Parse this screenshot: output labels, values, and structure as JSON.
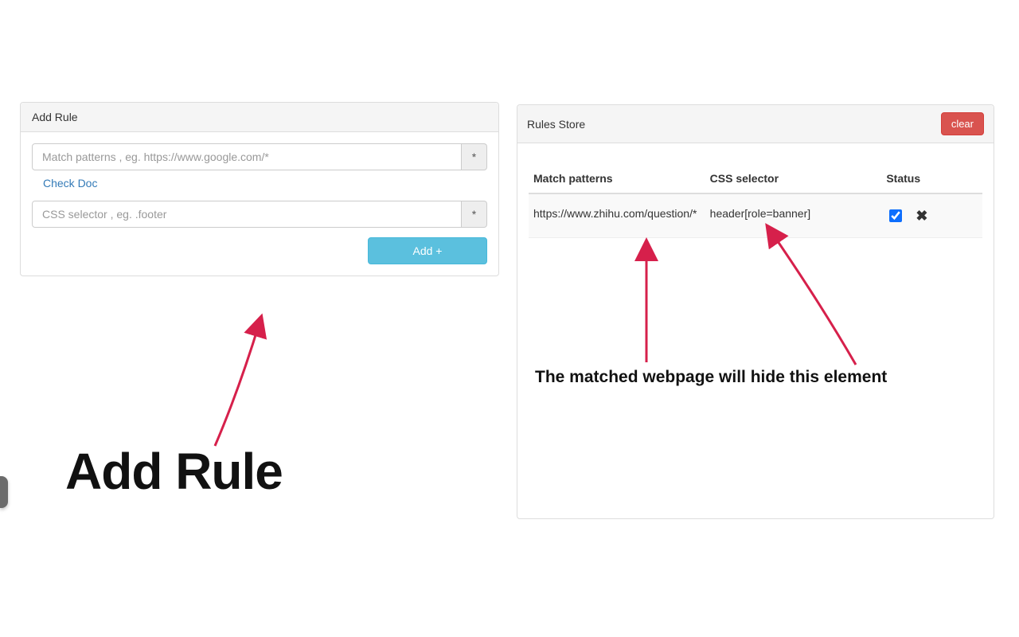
{
  "addRule": {
    "title": "Add Rule",
    "pattern_placeholder": "Match patterns , eg. https://www.google.com/*",
    "addon_star": "*",
    "check_doc": "Check Doc",
    "selector_placeholder": "CSS selector , eg. .footer",
    "add_btn": "Add +"
  },
  "rulesStore": {
    "title": "Rules Store",
    "clear_btn": "clear",
    "columns": {
      "pattern": "Match patterns",
      "selector": "CSS selector",
      "status": "Status"
    },
    "rows": [
      {
        "pattern": "https://www.zhihu.com/question/*",
        "selector": "header[role=banner]",
        "enabled": true
      }
    ]
  },
  "annotations": {
    "big": "Add Rule",
    "desc": "The matched webpage will hide this element"
  }
}
